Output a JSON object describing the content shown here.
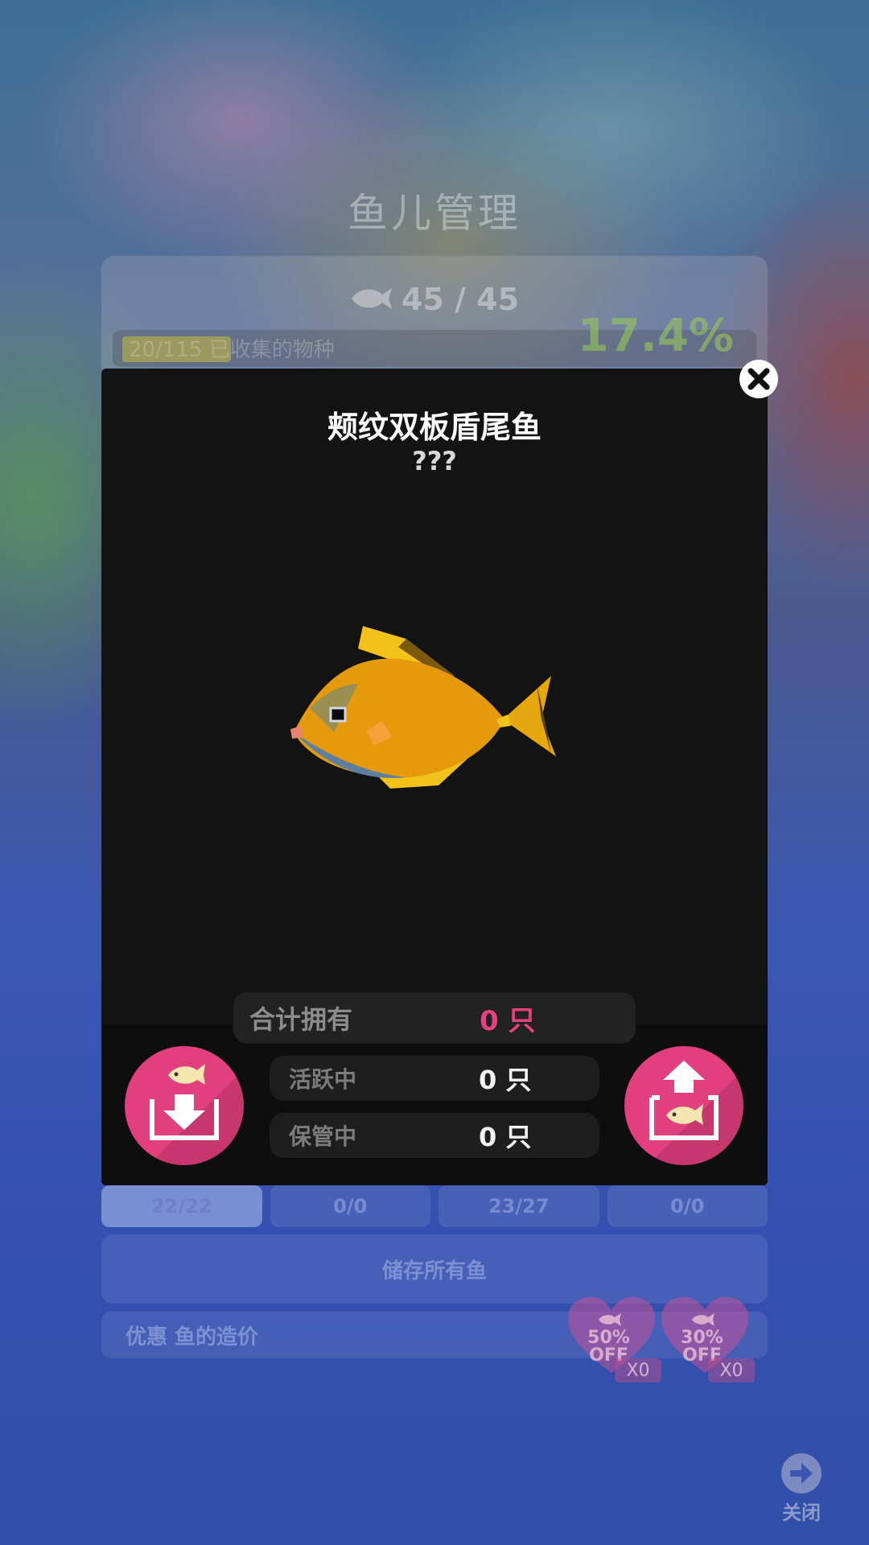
{
  "background": {
    "title": "鱼儿管理",
    "fish_count": "45 / 45",
    "progress_text": "20/115 已收集的物种",
    "progress_fraction": 0.174,
    "percent": "17.4%",
    "tabs": [
      {
        "label": "22/22",
        "active": true
      },
      {
        "label": "0/0",
        "active": false
      },
      {
        "label": "23/27",
        "active": false
      },
      {
        "label": "0/0",
        "active": false
      }
    ],
    "store_all_label": "储存所有鱼",
    "discount_label": "优惠 鱼的造价",
    "coupons": [
      {
        "line1": "50%",
        "line2": "OFF",
        "count": "X0"
      },
      {
        "line1": "30%",
        "line2": "OFF",
        "count": "X0"
      }
    ],
    "close_label": "关闭"
  },
  "modal": {
    "fish_name": "颊纹双板盾尾鱼",
    "fish_subtitle": "???",
    "total_label": "合计拥有",
    "total_value": "0 只",
    "active_label": "活跃中",
    "active_value": "0 只",
    "stored_label": "保管中",
    "stored_value": "0 只"
  },
  "colors": {
    "accent_pink": "#e23f7e",
    "modal_bg": "#131313",
    "fish_orange": "#e59a0c",
    "fish_yellow": "#f2c21a"
  },
  "icons": {
    "close": "close-icon",
    "store": "store-fish-icon",
    "retrieve": "retrieve-fish-icon",
    "fish": "fish-icon",
    "exit": "arrow-right-icon"
  }
}
